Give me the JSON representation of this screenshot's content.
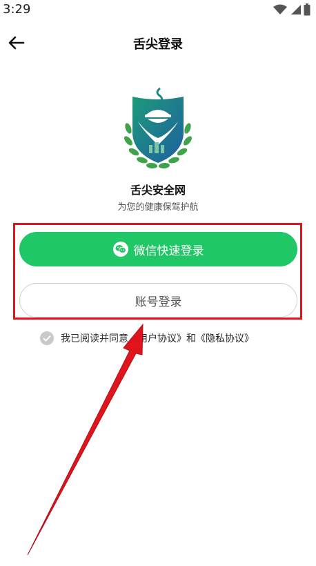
{
  "status_bar": {
    "time": "3:29"
  },
  "header": {
    "title": "舌尖登录"
  },
  "app": {
    "name": "舌尖安全网",
    "slogan": "为您的健康保驾护航"
  },
  "buttons": {
    "wechat_label": "微信快速登录",
    "account_label": "账号登录"
  },
  "agreement": {
    "prefix": "我已阅读并同意",
    "user_agreement": "《用户协议》",
    "conjunction": "和",
    "privacy_agreement": "《隐私协议》"
  },
  "colors": {
    "primary_green": "#1fc766",
    "annotation_red": "#e0141c",
    "logo_teal": "#1d8a84",
    "logo_blue": "#1f5fa0"
  }
}
